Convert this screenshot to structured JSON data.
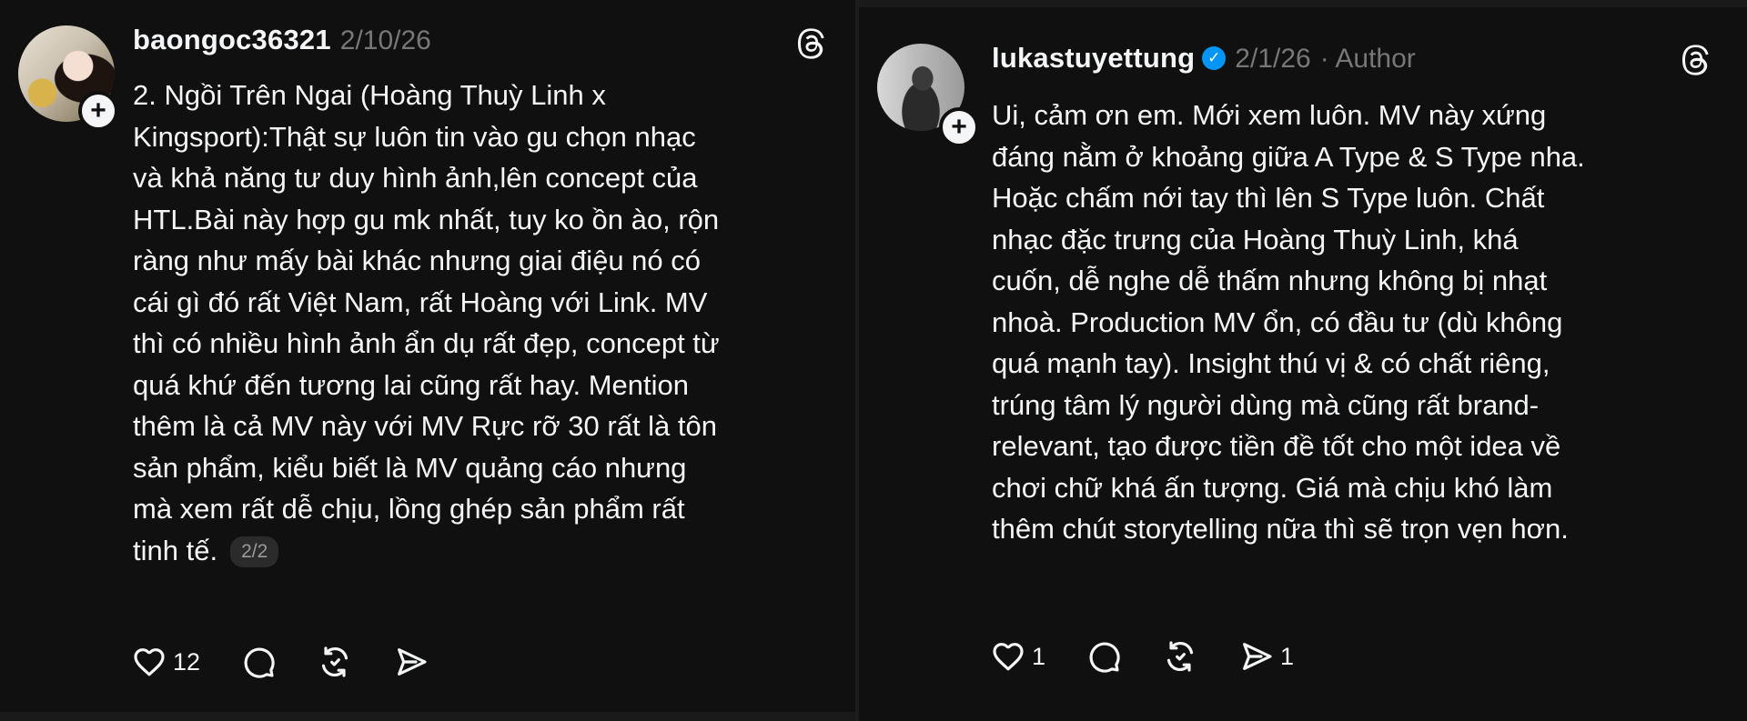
{
  "colors": {
    "background": "#101010",
    "text": "#f3f5f7",
    "muted": "#777777",
    "verified": "#0095f6"
  },
  "posts": [
    {
      "username": "baongoc36321",
      "date": "2/10/26",
      "author_tag": "",
      "verified": false,
      "text": "2. Ngồi Trên Ngai (Hoàng Thuỳ Linh x\nKingsport):Thật sự luôn tin vào gu chọn nhạc\nvà khả năng tư duy hình ảnh,lên concept của\nHTL.Bài này hợp gu mk nhất, tuy ko ồn ào, rộn\nràng như mấy bài khác nhưng giai điệu nó có\ncái gì đó rất Việt Nam, rất Hoàng với Link. MV\nthì có nhiều hình ảnh ẩn dụ rất đẹp, concept từ\nquá khứ đến tương lai cũng rất hay. Mention\nthêm là cả MV này với MV Rực rỡ 30 rất là tôn\nsản phẩm, kiểu biết là MV quảng cáo nhưng\nmà xem rất dễ chịu, lồng ghép sản phẩm rất\ntinh tế.",
      "page_indicator": "2/2",
      "likes": "12",
      "replies": "",
      "reposts": "",
      "shares": "",
      "icons": [
        "heart-icon",
        "comment-icon",
        "repost-icon",
        "share-icon",
        "threads-logo-icon",
        "follow-plus-icon"
      ]
    },
    {
      "username": "lukastuyettung",
      "date": "2/1/26",
      "author_tag": "· Author",
      "verified": true,
      "text": "Ui, cảm ơn em. Mới xem luôn. MV này xứng\nđáng nằm ở khoảng giữa A Type & S Type nha.\nHoặc chấm nới tay thì lên S Type luôn. Chất\nnhạc đặc trưng của Hoàng Thuỳ Linh, khá\ncuốn, dễ nghe dễ thấm nhưng không bị nhạt\nnhoà. Production MV ổn, có đầu tư (dù không\nquá mạnh tay). Insight thú vị & có chất riêng,\ntrúng tâm lý người dùng mà cũng rất brand-\nrelevant, tạo được tiền đề tốt cho một idea về\nchơi chữ khá ấn tượng. Giá mà chịu khó làm\nthêm chút storytelling nữa thì sẽ trọn vẹn hơn.",
      "page_indicator": "",
      "likes": "1",
      "replies": "",
      "reposts": "",
      "shares": "1",
      "icons": [
        "heart-icon",
        "comment-icon",
        "repost-icon",
        "share-icon",
        "threads-logo-icon",
        "follow-plus-icon",
        "verified-badge-icon"
      ]
    }
  ],
  "glyphs": {
    "plus": "+",
    "check": "✓"
  }
}
